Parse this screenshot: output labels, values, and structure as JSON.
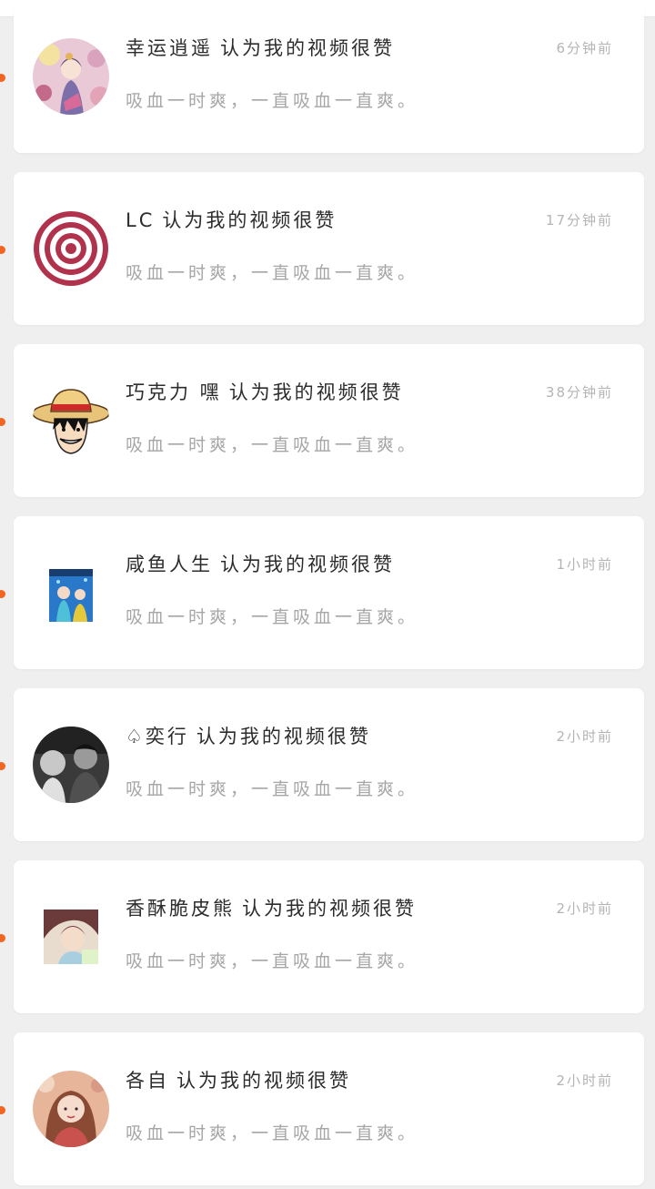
{
  "theme": {
    "accent": "#1fb8c3",
    "unread_dot": "#f26522",
    "card_bg": "#ffffff",
    "page_bg": "#efefef"
  },
  "notifications": [
    {
      "name": "幸运逍遥",
      "action": "认为我的视频很赞",
      "comment": "吸血一时爽，一直吸血一直爽。",
      "time": "6分钟前",
      "avatar_icon": "anime-girl-avatar"
    },
    {
      "name": "LC",
      "action": "认为我的视频很赞",
      "comment": "吸血一时爽，一直吸血一直爽。",
      "time": "17分钟前",
      "avatar_icon": "target-rings-avatar"
    },
    {
      "name": "巧克力 嘿",
      "action": "认为我的视频很赞",
      "comment": "吸血一时爽，一直吸血一直爽。",
      "time": "38分钟前",
      "avatar_icon": "straw-hat-avatar"
    },
    {
      "name": "咸鱼人生",
      "action": "认为我的视频很赞",
      "comment": "吸血一时爽，一直吸血一直爽。",
      "time": "1小时前",
      "avatar_icon": "anime-poster-avatar"
    },
    {
      "name": "♤奕行",
      "action": "认为我的视频很赞",
      "comment": "吸血一时爽，一直吸血一直爽。",
      "time": "2小时前",
      "avatar_icon": "bw-photo-avatar"
    },
    {
      "name": "香酥脆皮熊",
      "action": "认为我的视频很赞",
      "comment": "吸血一时爽，一直吸血一直爽。",
      "time": "2小时前",
      "avatar_icon": "anime-boy-avatar"
    },
    {
      "name": "各自",
      "action": "认为我的视频很赞",
      "comment": "吸血一时爽，一直吸血一直爽。",
      "time": "2小时前",
      "avatar_icon": "girl-photo-avatar"
    }
  ]
}
